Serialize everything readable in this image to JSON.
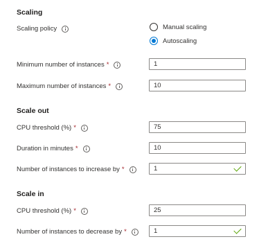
{
  "scaling": {
    "title": "Scaling",
    "policy_label": "Scaling policy",
    "options": [
      {
        "label": "Manual scaling",
        "selected": false
      },
      {
        "label": "Autoscaling",
        "selected": true
      }
    ],
    "min_instances_label": "Minimum number of instances",
    "min_instances_value": "1",
    "max_instances_label": "Maximum number of instances",
    "max_instances_value": "10"
  },
  "scale_out": {
    "title": "Scale out",
    "cpu_label": "CPU threshold (%)",
    "cpu_value": "75",
    "duration_label": "Duration in minutes",
    "duration_value": "10",
    "increase_label": "Number of instances to increase by",
    "increase_value": "1"
  },
  "scale_in": {
    "title": "Scale in",
    "cpu_label": "CPU threshold (%)",
    "cpu_value": "25",
    "decrease_label": "Number of instances to decrease by",
    "decrease_value": "1"
  },
  "required_marker": "*",
  "colors": {
    "accent": "#0078d4",
    "required": "#a4262c",
    "valid": "#57a300"
  }
}
